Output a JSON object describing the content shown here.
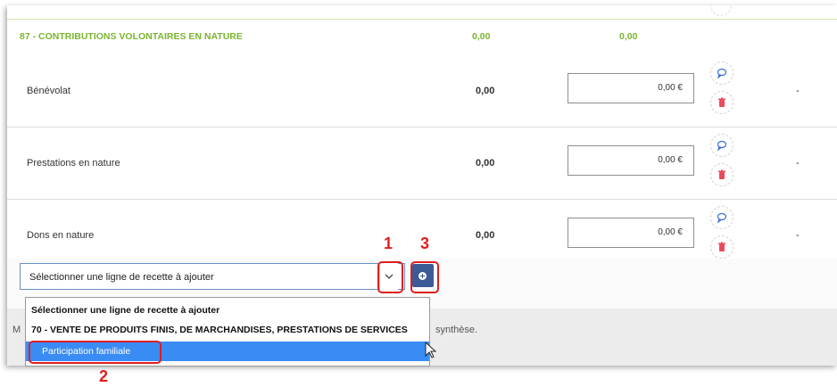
{
  "section": {
    "title": "87 - CONTRIBUTIONS VOLONTAIRES EN NATURE",
    "value1": "0,00",
    "value2": "0,00"
  },
  "rows": [
    {
      "label": "Bénévolat",
      "value": "0,00",
      "amount": "0,00 €",
      "dash": "-"
    },
    {
      "label": "Prestations en nature",
      "value": "0,00",
      "amount": "0,00 €",
      "dash": "-"
    },
    {
      "label": "Dons en nature",
      "value": "0,00",
      "amount": "0,00 €",
      "dash": "-"
    }
  ],
  "add_line": {
    "select_text": "Sélectionner une ligne de recette à ajouter"
  },
  "dropdown": {
    "options": [
      "Sélectionner une ligne de recette à ajouter",
      "70 - VENTE DE PRODUITS FINIS, DE MARCHANDISES, PRESTATIONS DE SERVICES",
      "Participation familiale"
    ]
  },
  "footer": {
    "left_letter": "M",
    "right_text": "synthèse."
  },
  "annotations": {
    "step1": "1",
    "step2": "2",
    "step3": "3",
    "color": "#e01e1e"
  },
  "colors": {
    "section_green": "#7ab52f",
    "button_blue": "#3c5a96",
    "highlight_blue": "#3a8cf5",
    "trash_red": "#e84a5f"
  }
}
